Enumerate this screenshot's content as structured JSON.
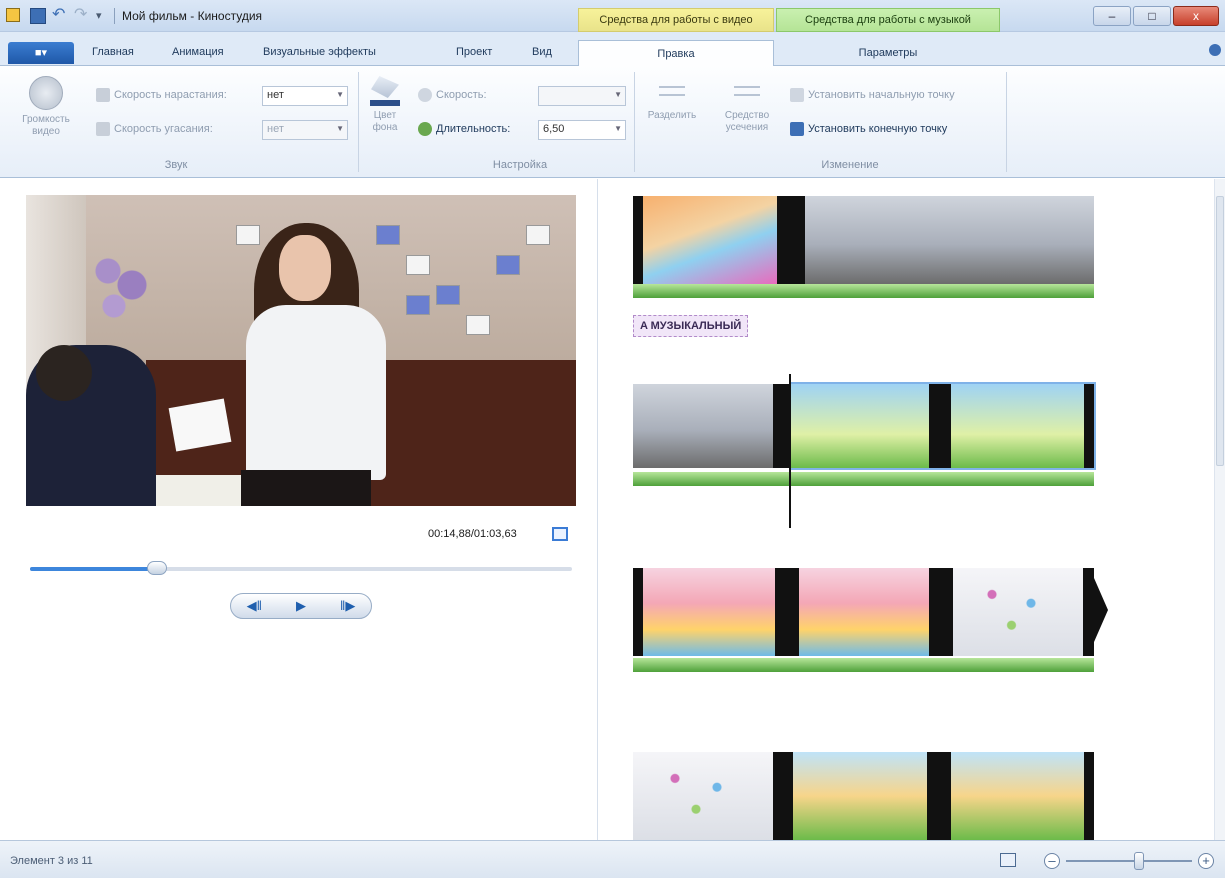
{
  "titlebar": {
    "window_title": "Мой фильм - Киностудия",
    "context_video": "Средства для работы с видео",
    "context_music": "Средства для работы с музыкой",
    "minimize": "–",
    "maximize": "□",
    "close": "x"
  },
  "tabs": {
    "file": "■▾",
    "items": [
      "Главная",
      "Анимация",
      "Визуальные эффекты",
      "Проект",
      "Вид"
    ],
    "active": "Правка",
    "params": "Параметры"
  },
  "ribbon": {
    "sound": {
      "volume_label": "Громкость видео",
      "fade_in_label": "Скорость нарастания:",
      "fade_in_value": "нет",
      "fade_out_label": "Скорость угасания:",
      "fade_out_value": "нет",
      "group_label": "Звук"
    },
    "settings": {
      "bg_color_label": "Цвет фона",
      "speed_label": "Скорость:",
      "speed_value": "",
      "duration_label": "Длительность:",
      "duration_value": "6,50",
      "group_label": "Настройка"
    },
    "edit": {
      "split_label": "Разделить",
      "trim_label": "Средство усечения",
      "set_start": "Установить начальную точку",
      "set_end": "Установить конечную точку",
      "group_label": "Изменение"
    }
  },
  "preview": {
    "timecode": "00:14,88/01:03,63",
    "position_fraction": 0.234,
    "prev_frame": "◀‖",
    "play": "▶",
    "next_frame": "‖▶"
  },
  "storyboard": {
    "caption": "A МУЗЫКАЛЬНЫЙ"
  },
  "status": {
    "item_text": "Элемент 3 из 11",
    "zoom_minus": "–",
    "zoom_plus": "+"
  }
}
